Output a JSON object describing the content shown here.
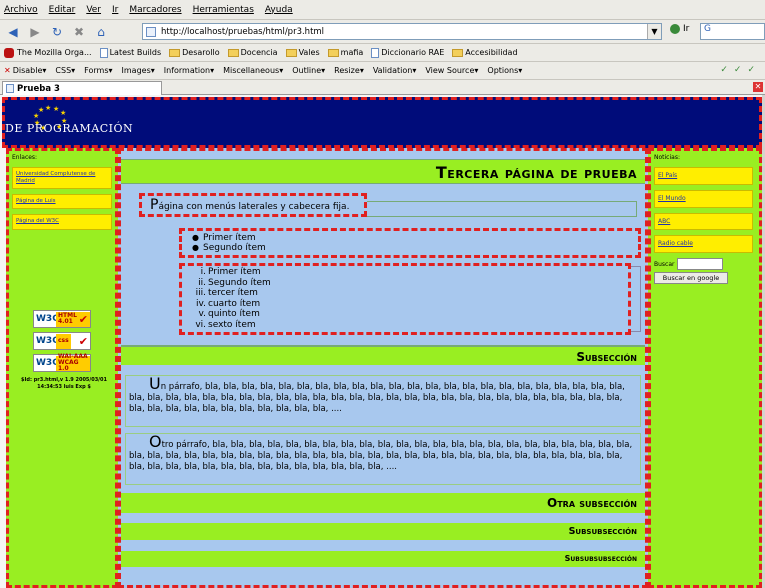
{
  "browser": {
    "menu": [
      "Archivo",
      "Editar",
      "Ver",
      "Ir",
      "Marcadores",
      "Herramientas",
      "Ayuda"
    ],
    "url": "http://localhost/pruebas/html/pr3.html",
    "go_label": "Ir",
    "search_placeholder": "G",
    "bookmarks": [
      "The Mozilla Orga...",
      "Latest Builds",
      "Desarollo",
      "Docencia",
      "Vales",
      "mafia",
      "Diccionario RAE",
      "Accesibilidad"
    ],
    "devtools": [
      "Disable",
      "CSS",
      "Forms",
      "Images",
      "Information",
      "Miscellaneous",
      "Outline",
      "Resize",
      "Validation",
      "View Source",
      "Options"
    ],
    "tab_title": "Prueba 3"
  },
  "header": {
    "logo_text": "DE PROGRAMACIÓN"
  },
  "left": {
    "label": "Enlaces:",
    "links": [
      "Universidad Complutense de Madrid",
      "Página de Luis",
      "Página del W3C"
    ],
    "badges": [
      {
        "w3": "W3C",
        "tag": "HTML 4.01"
      },
      {
        "w3": "W3C",
        "tag": "css"
      },
      {
        "w3": "W3C",
        "tag": "WAI-AAA WCAG 1.0"
      }
    ],
    "id_text": "$Id: pr3.html,v 1.9 2005/03/01 14:34:53 luis Exp $"
  },
  "main": {
    "title": "Tercera página de prueba",
    "intro_cap": "P",
    "intro_rest": "ágina con menús laterales y cabecera fija.",
    "ul_items": [
      "Primer ítem",
      "Segundo ítem"
    ],
    "ol_numbers": [
      "i.",
      "ii.",
      "iii.",
      "iv.",
      "v.",
      "vi."
    ],
    "ol_items": [
      "Primer ítem",
      "Segundo ítem",
      "tercer ítem",
      "cuarto ítem",
      "quinto ítem",
      "sexto ítem"
    ],
    "subsection": "Subsección",
    "para1_cap": "U",
    "para1_rest": "n párrafo, bla, bla, bla, bla, bla, bla, bla, bla, bla, bla, bla, bla, bla, bla, bla, bla, bla, bla, bla, bla, bla, bla, bla, bla, bla, bla, bla, bla, bla, bla, bla, bla, bla, bla, bla, bla, bla, bla, bla, bla, bla, bla, bla, bla, bla, bla, bla, bla, bla, bla, bla, bla, bla, bla, bla, bla, bla, bla, bla, bla, bla, ....",
    "para2_cap": "O",
    "para2_rest": "tro párrafo, bla, bla, bla, bla, bla, bla, bla, bla, bla, bla, bla, bla, bla, bla, bla, bla, bla, bla, bla, bla, bla, bla, bla, bla, bla, bla, bla, bla, bla, bla, bla, bla, bla, bla, bla, bla, bla, bla, bla, bla, bla, bla, bla, bla, bla, bla, bla, bla, bla, bla, bla, bla, bla, bla, bla, bla, bla, bla, bla, bla, bla, bla, bla, bla, ....",
    "subsection2": "Otra subsección",
    "subsubsection": "Subsubsección",
    "subsubsubsection": "Subsubsubsección"
  },
  "right": {
    "label": "Noticias:",
    "links": [
      "El País",
      "El Mundo",
      "ABC",
      "Radio cable"
    ],
    "search_label": "Buscar",
    "search_button": "Buscar en google"
  }
}
